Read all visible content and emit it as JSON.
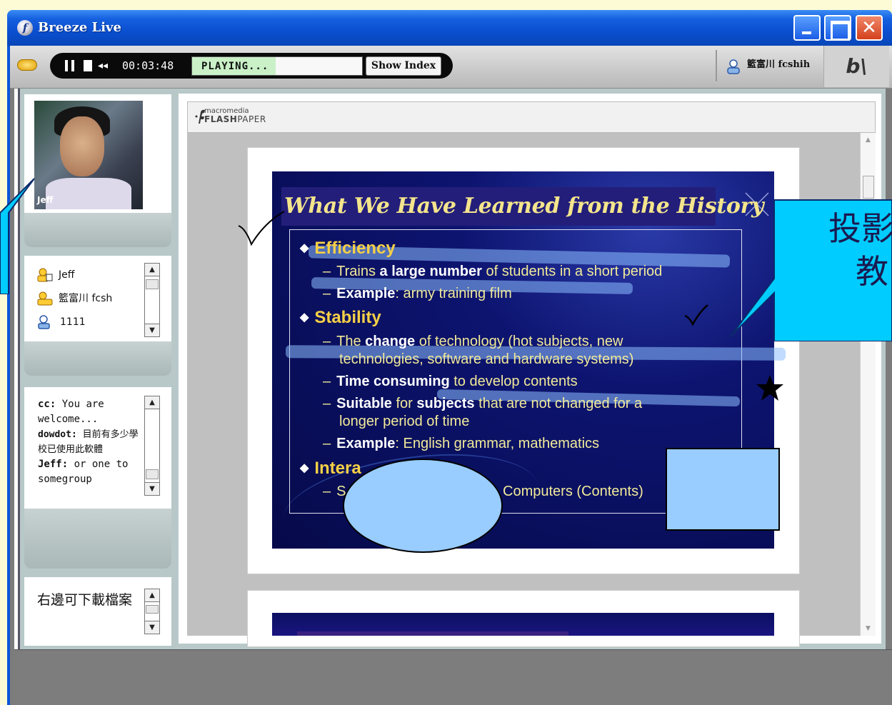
{
  "window": {
    "title": "Breeze Live",
    "logo_glyph": "f"
  },
  "player": {
    "elapsed": "00:03:48",
    "status": "PLAYING...",
    "progress_fraction": 0.49,
    "show_index_label": "Show Index",
    "rewind_glyph": "◂◂"
  },
  "user": {
    "name": "籃富川 fcshih",
    "app_badge": "b\\"
  },
  "camera": {
    "name": "Jeff"
  },
  "attendees": {
    "items": [
      {
        "name": "Jeff",
        "role": "host"
      },
      {
        "name": "籃富川 fcsh",
        "role": "presenter"
      },
      {
        "name": "1111",
        "role": "participant"
      }
    ]
  },
  "chat": {
    "messages": [
      {
        "sender": "cc:",
        "text": " You are welcome..."
      },
      {
        "sender": "dowdot:",
        "text": " 目前有多少學校已使用此軟體"
      },
      {
        "sender": "Jeff:",
        "text": " or one to somegroup"
      }
    ]
  },
  "note": {
    "text": "右邊可下載檔案"
  },
  "flashpaper": {
    "brand_small": "macromedia",
    "brand_big_bold": "FLASH",
    "brand_big_light": "PAPER"
  },
  "slide": {
    "title": "What We Have Learned from the History",
    "bullets": [
      {
        "label": "Efficiency",
        "subs": [
          {
            "pre": "Trains ",
            "bold": "a large number",
            "post": " of students in a short period"
          },
          {
            "pre": "",
            "bold": "Example",
            "post": ": army training film"
          }
        ]
      },
      {
        "label": "Stability",
        "subs": [
          {
            "pre": "The ",
            "bold": "change",
            "post": " of technology (hot subjects, new"
          },
          {
            "pre": "technologies, software and hardware systems)",
            "bold": "",
            "post": ""
          },
          {
            "pre": "",
            "bold": "Time consuming",
            "post": " to develop contents"
          },
          {
            "pre": "",
            "bold": "Suitable",
            "post": " for ",
            "bold2": "subjects",
            "post2": " that are not changed for a"
          },
          {
            "pre": "longer period of time",
            "bold": "",
            "post": ""
          },
          {
            "pre": "",
            "bold": "Example",
            "post": ": English grammar, mathematics"
          }
        ]
      },
      {
        "label": "Intera",
        "subs": [
          {
            "pre": "S",
            "bold": "",
            "post": ""
          },
          {
            "pre": "Computers (Contents)",
            "bold": "",
            "post": ""
          }
        ]
      }
    ]
  },
  "annotations": {
    "callout_right_line1": "投影",
    "callout_right_line2": "教",
    "callout_color": "#00ccff",
    "shape_fill": "#99ccff"
  },
  "colors": {
    "titlebar": "#0a4fd0",
    "slide_bg": "#060a4a",
    "bullet": "#f6d046"
  }
}
